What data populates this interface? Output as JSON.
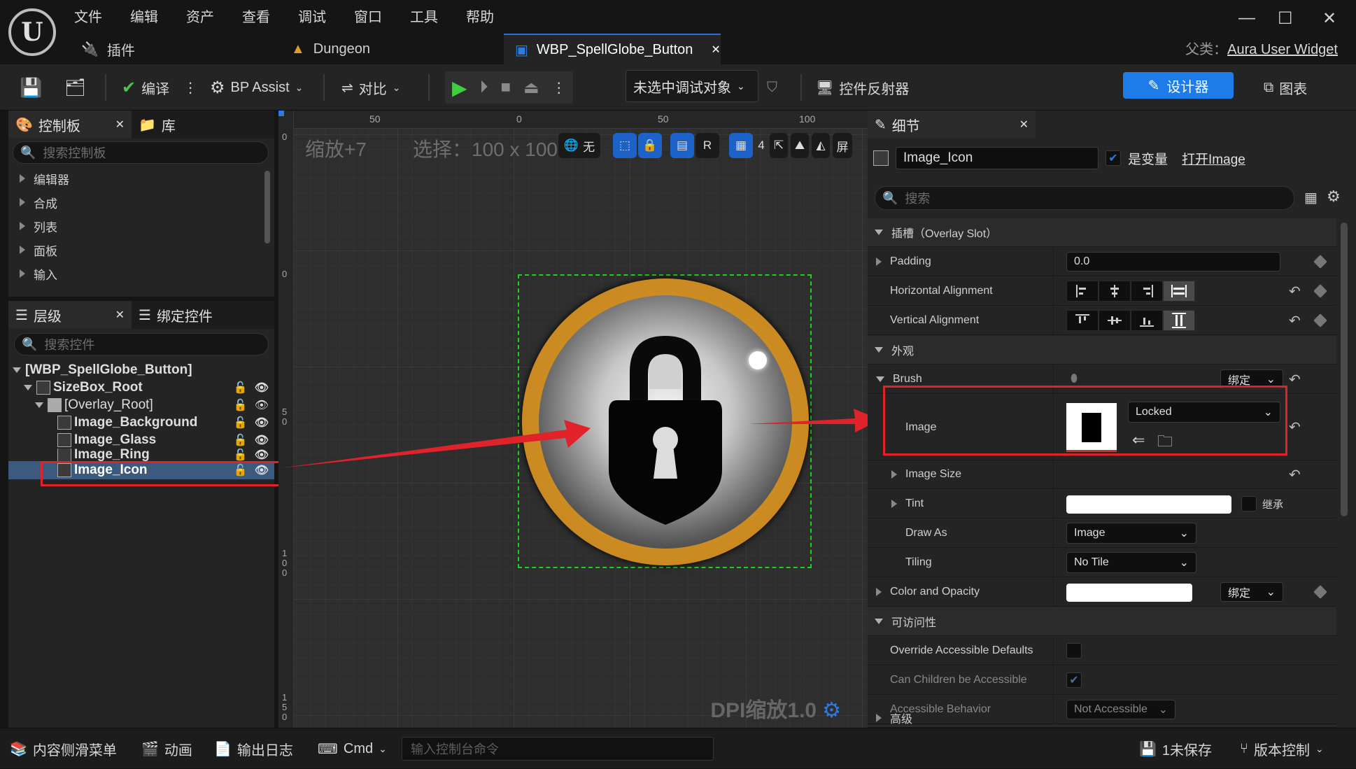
{
  "app": {
    "logo_letter": "U"
  },
  "menu": [
    "文件",
    "编辑",
    "资产",
    "查看",
    "调试",
    "窗口",
    "工具",
    "帮助"
  ],
  "tabs": [
    {
      "label": "插件"
    },
    {
      "label": "Dungeon"
    },
    {
      "label": "WBP_SpellGlobe_Button",
      "active": true
    }
  ],
  "parent": {
    "prefix": "父类：",
    "name": "Aura User Widget"
  },
  "toolbar": {
    "compile": "编译",
    "bp_assist": "BP Assist",
    "diff": "对比",
    "debug_target": "未选中调试对象",
    "widget_reflector": "控件反射器",
    "designer": "设计器",
    "graph": "图表"
  },
  "palette": {
    "tab_palette": "控制板",
    "tab_library": "库",
    "search_placeholder": "搜索控制板",
    "items": [
      "编辑器",
      "合成",
      "列表",
      "面板",
      "输入"
    ]
  },
  "hierarchy": {
    "tab_hierarchy": "层级",
    "tab_bind": "绑定控件",
    "search_placeholder": "搜索控件",
    "root": "[WBP_SpellGlobe_Button]",
    "items": [
      "SizeBox_Root",
      "[Overlay_Root]",
      "Image_Background",
      "Image_Glass",
      "Image_Ring",
      "Image_Icon"
    ]
  },
  "viewport": {
    "zoom": "缩放+7",
    "selection": "选择：100 x 100",
    "none": "无",
    "r_label": "R",
    "grid_count": "4",
    "screen": "屏",
    "dpi": "DPI缩放1.0",
    "ruler_top": [
      "50",
      "0",
      "50",
      "100"
    ],
    "ruler_left": [
      "0",
      "0",
      "5\n0",
      "1\n0\n0",
      "1\n5\n0"
    ]
  },
  "details": {
    "tab": "细节",
    "widget_name": "Image_Icon",
    "is_variable": "是变量",
    "open_image": "打开Image",
    "search_placeholder": "搜索",
    "slot_section": "插槽（Overlay Slot）",
    "padding_label": "Padding",
    "padding_value": "0.0",
    "halign_label": "Horizontal Alignment",
    "valign_label": "Vertical Alignment",
    "appearance_section": "外观",
    "brush_label": "Brush",
    "bind_label": "绑定",
    "image_label": "Image",
    "image_asset": "Locked",
    "image_size_label": "Image Size",
    "tint_label": "Tint",
    "inherit_label": "继承",
    "draw_as_label": "Draw As",
    "draw_as_value": "Image",
    "tiling_label": "Tiling",
    "tiling_value": "No Tile",
    "color_opacity_label": "Color and Opacity",
    "accessibility_section": "可访问性",
    "override_label": "Override Accessible Defaults",
    "children_label": "Can Children be Accessible",
    "behavior_label": "Accessible Behavior",
    "behavior_value": "Not Accessible",
    "advanced_section": "高级"
  },
  "statusbar": {
    "content_drawer": "内容侧滑菜单",
    "animation": "动画",
    "output_log": "输出日志",
    "cmd": "Cmd",
    "console_placeholder": "输入控制台命令",
    "unsaved": "1未保存",
    "source_control": "版本控制"
  },
  "colors": {
    "accent": "#1d7ce8",
    "highlight_box": "#e0222a",
    "selection": "#3b5a7e",
    "green_bounds": "#19d419"
  }
}
